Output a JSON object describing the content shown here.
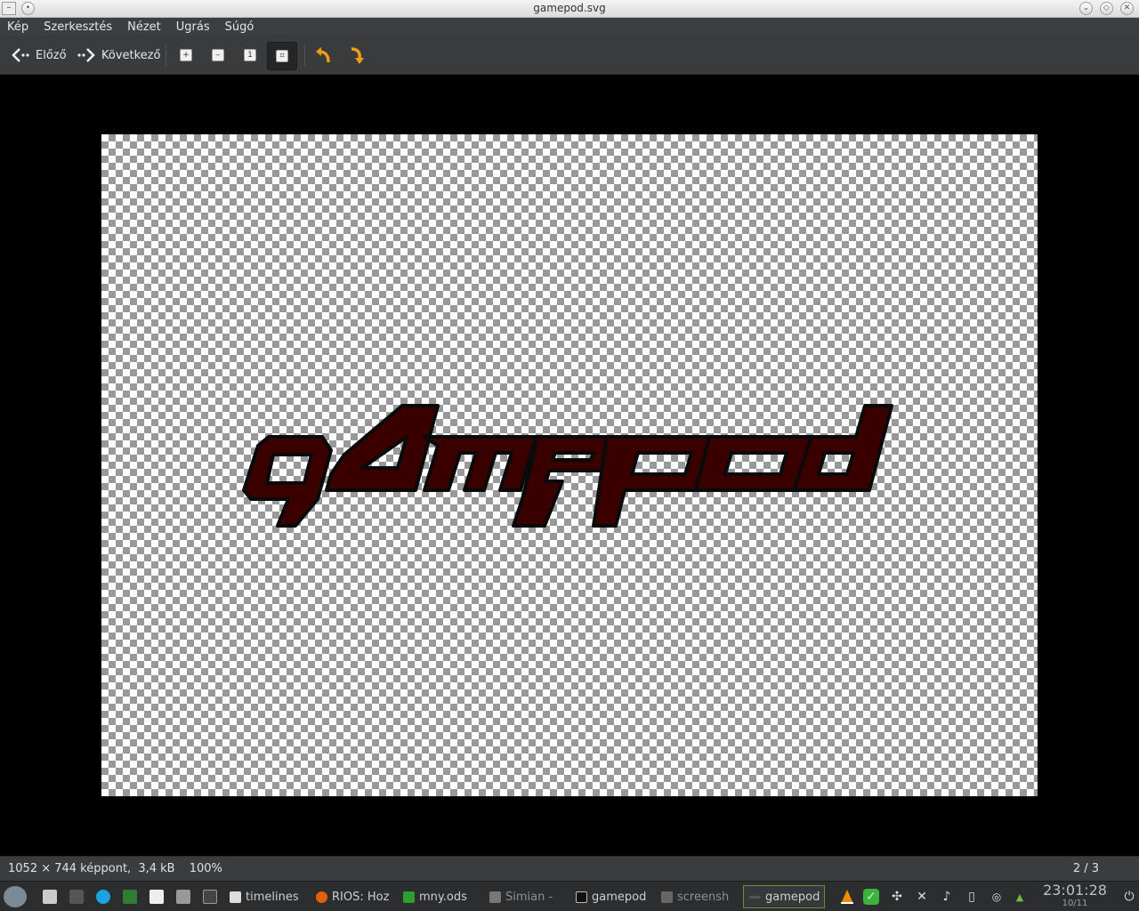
{
  "window": {
    "title": "gamepod.svg"
  },
  "menu": {
    "items": [
      "Kép",
      "Szerkesztés",
      "Nézet",
      "Ugrás",
      "Súgó"
    ]
  },
  "toolbar": {
    "prev_label": "Előző",
    "next_label": "Következő"
  },
  "image": {
    "logo_text": "gamepod",
    "logo_fill": "#3a0000",
    "logo_stroke": "#0a0a0a"
  },
  "statusbar": {
    "dimensions": "1052 × 744 képpont,",
    "size": "3,4 kB",
    "zoom": "100%",
    "position": "2 / 3"
  },
  "taskbar": {
    "tasks": [
      {
        "label": "timelines",
        "icon": "document-icon"
      },
      {
        "label": "RIOS: Hoz",
        "icon": "firefox-icon"
      },
      {
        "label": "mny.ods",
        "icon": "spreadsheet-icon"
      },
      {
        "label": "Simian - ",
        "icon": "simian-icon"
      },
      {
        "label": "gamepod",
        "icon": "inkscape-icon"
      },
      {
        "label": "screensh",
        "icon": "screenshot-icon"
      },
      {
        "label": "gamepod",
        "icon": "image-viewer-icon"
      }
    ],
    "clock_time": "23:01:28",
    "clock_date": "10/11"
  }
}
